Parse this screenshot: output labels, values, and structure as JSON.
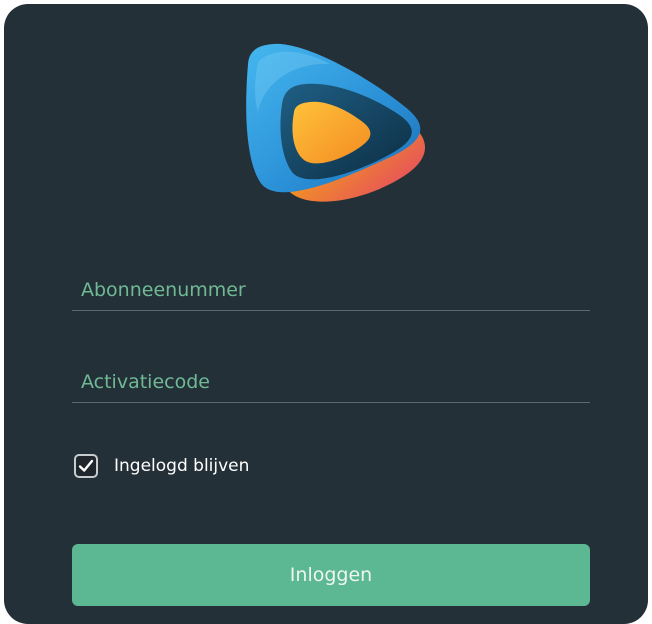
{
  "form": {
    "subscriber_placeholder": "Abonneenummer",
    "subscriber_value": "",
    "activation_placeholder": "Activatiecode",
    "activation_value": "",
    "remember_label": "Ingelogd blijven",
    "remember_checked": true,
    "login_label": "Inloggen"
  },
  "icons": {
    "logo": "play-triangle-logo-icon",
    "check": "checkmark-icon"
  },
  "colors": {
    "card_background": "#243037",
    "accent": "#5cb793",
    "placeholder": "#6fb995",
    "logo_blue": "#2ea8e6",
    "logo_orange": "#f5a623",
    "logo_pink": "#e0486a"
  }
}
